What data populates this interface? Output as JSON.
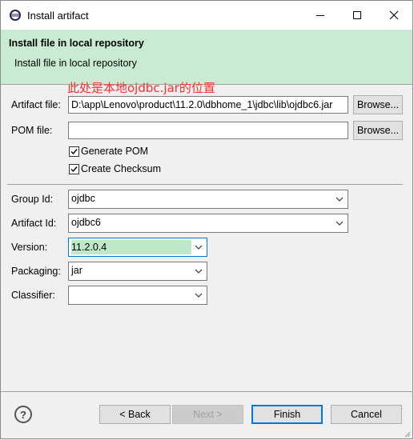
{
  "window": {
    "title": "Install artifact",
    "icon": "eclipse-icon"
  },
  "banner": {
    "title": "Install file in local repository",
    "description": "Install file in local repository"
  },
  "annotation": "此处是本地ojdbc.jar的位置",
  "form": {
    "artifact_file_label": "Artifact file:",
    "artifact_file_value": "D:\\app\\Lenovo\\product\\11.2.0\\dbhome_1\\jdbc\\lib\\ojdbc6.jar",
    "pom_file_label": "POM file:",
    "pom_file_value": "",
    "browse_label": "Browse...",
    "generate_pom_label": "Generate POM",
    "generate_pom_checked": true,
    "create_checksum_label": "Create Checksum",
    "create_checksum_checked": true,
    "group_id_label": "Group Id:",
    "group_id_value": "ojdbc",
    "artifact_id_label": "Artifact Id:",
    "artifact_id_value": "ojdbc6",
    "version_label": "Version:",
    "version_value": "11.2.0.4",
    "packaging_label": "Packaging:",
    "packaging_value": "jar",
    "classifier_label": "Classifier:",
    "classifier_value": ""
  },
  "buttons": {
    "back": "< Back",
    "next": "Next >",
    "finish": "Finish",
    "cancel": "Cancel",
    "help": "?"
  },
  "colors": {
    "banner_bg": "#c9ebd3",
    "annotation": "#ff2a2a",
    "focus_border": "#0078d7"
  }
}
